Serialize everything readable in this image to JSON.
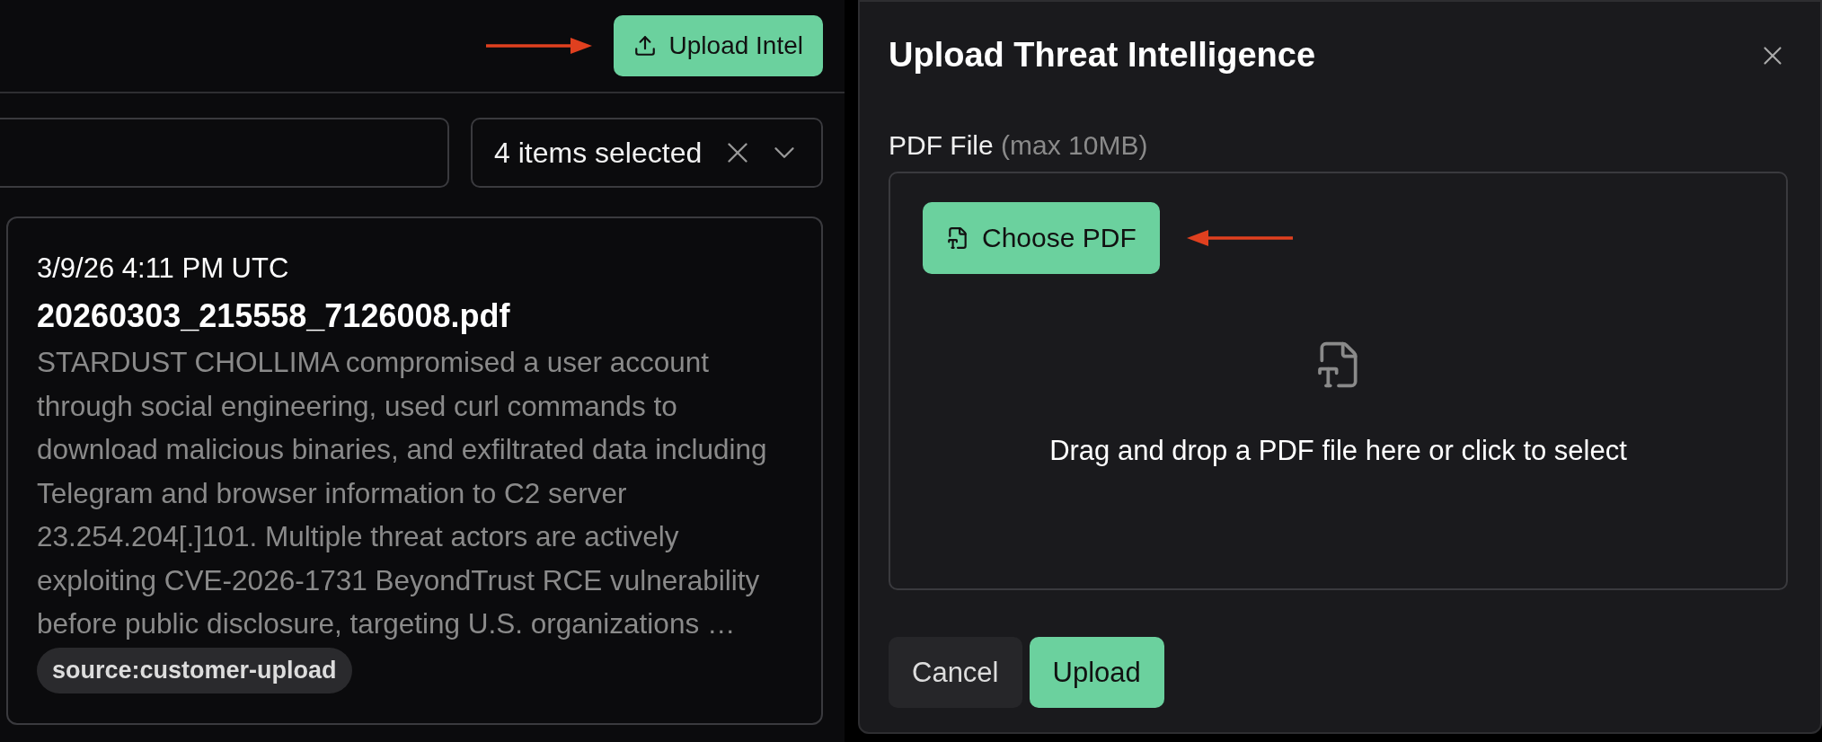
{
  "header": {
    "upload_button": "Upload Intel"
  },
  "filters": {
    "select": {
      "value": "4 items selected"
    }
  },
  "card": {
    "timestamp": "3/9/26 4:11 PM UTC",
    "filename": "20260303_215558_7126008.pdf",
    "summary_lines": [
      "STARDUST CHOLLIMA compromised a user account",
      "through social engineering, used curl commands to",
      "download malicious binaries, and exfiltrated data including",
      "Telegram and browser information to C2 server",
      "23.254.204[.]101. Multiple threat actors are actively",
      "exploiting CVE-2026-1731 BeyondTrust RCE vulnerability",
      "before public disclosure, targeting U.S. organizations …"
    ],
    "tags": [
      "source:customer-upload"
    ]
  },
  "dialog": {
    "title": "Upload Threat Intelligence",
    "field_label": "PDF File",
    "field_hint": "(max 10MB)",
    "choose_button": "Choose PDF",
    "drop_text": "Drag and drop a PDF file here or click to select",
    "buttons": [
      {
        "label": "Cancel",
        "kind": "secondary"
      },
      {
        "label": "Upload",
        "kind": "primary"
      }
    ]
  }
}
